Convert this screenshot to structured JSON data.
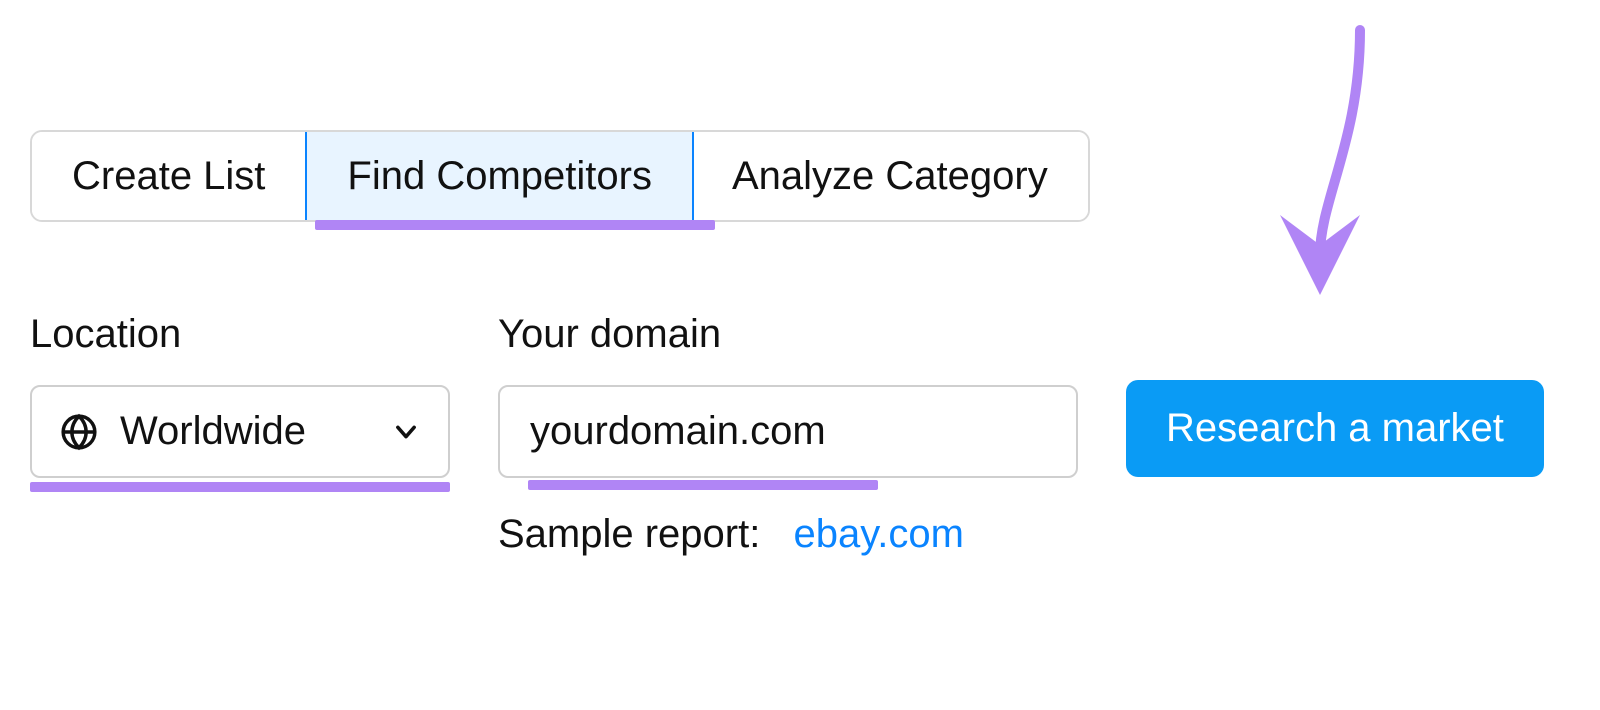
{
  "tabs": {
    "create": {
      "label": "Create List"
    },
    "find": {
      "label": "Find Competitors"
    },
    "analyze": {
      "label": "Analyze Category"
    }
  },
  "location": {
    "label": "Location",
    "value": "Worldwide"
  },
  "domain": {
    "label": "Your domain",
    "placeholder": "yourdomain.com"
  },
  "sample": {
    "label": "Sample report:",
    "link": "ebay.com"
  },
  "cta": {
    "label": "Research a market"
  },
  "colors": {
    "primary": "#0a9bf5",
    "link": "#0a84ff",
    "highlight": "#b085f5",
    "activeTabBg": "#e8f4ff",
    "activeTabBorder": "#0a84ff"
  }
}
